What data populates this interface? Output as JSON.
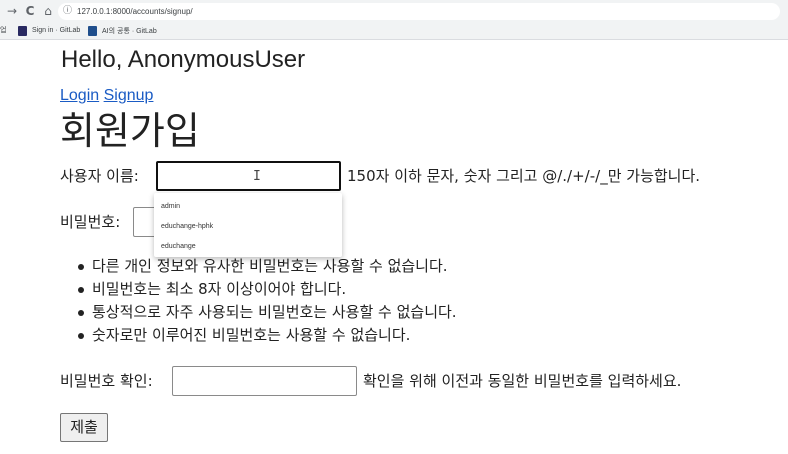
{
  "browser": {
    "nav": {
      "back_icon": "→",
      "reload_icon": "C",
      "home_icon": "⌂"
    },
    "url": "127.0.0.1:8000/accounts/signup/",
    "bookmarks": {
      "cut_label": "업",
      "items": [
        {
          "label": "Sign in · GitLab",
          "icon": "gitlab-icon"
        },
        {
          "label": "AI의 공통 · GitLab",
          "icon": "bookmark-icon"
        }
      ]
    }
  },
  "header": {
    "greeting": "Hello, AnonymousUser",
    "login_link": "Login",
    "signup_link": "Signup"
  },
  "page_title": "회원가입",
  "form": {
    "username": {
      "label": "사용자 이름:",
      "value": "",
      "help": "150자 이하 문자, 숫자 그리고 @/./+/-/_만 가능합니다."
    },
    "autocomplete": [
      "admin",
      "educhange-hphk",
      "educhange"
    ],
    "password": {
      "label": "비밀번호:",
      "value": "",
      "rules": [
        "다른 개인 정보와 유사한 비밀번호는 사용할 수 없습니다.",
        "비밀번호는 최소 8자 이상이어야 합니다.",
        "통상적으로 자주 사용되는 비밀번호는 사용할 수 없습니다.",
        "숫자로만 이루어진 비밀번호는 사용할 수 없습니다."
      ]
    },
    "password_confirm": {
      "label": "비밀번호 확인:",
      "value": "",
      "help": "확인을 위해 이전과 동일한 비밀번호를 입력하세요."
    },
    "submit_label": "제출"
  }
}
